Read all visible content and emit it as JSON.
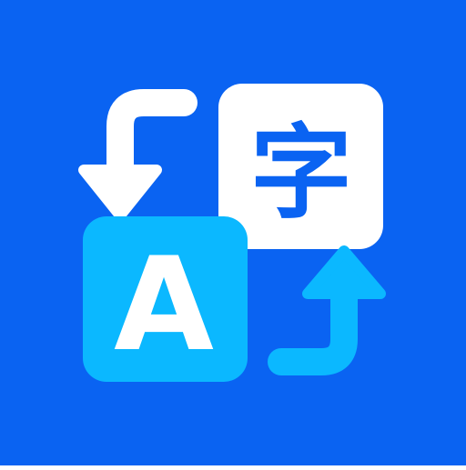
{
  "app_icon": {
    "name": "translate-app-icon",
    "colors": {
      "background": "#0A63F2",
      "source_tile": "#0BB8FF",
      "target_tile": "#FFFFFF",
      "source_glyph": "#FFFFFF",
      "target_glyph": "#0A63F2",
      "arrow_top": "#FFFFFF",
      "arrow_bottom": "#0BB8FF"
    },
    "source_glyph": "A",
    "target_glyph": "字",
    "icons": {
      "top_arrow": "curved-arrow-down-icon",
      "bottom_arrow": "curved-arrow-up-icon"
    }
  }
}
